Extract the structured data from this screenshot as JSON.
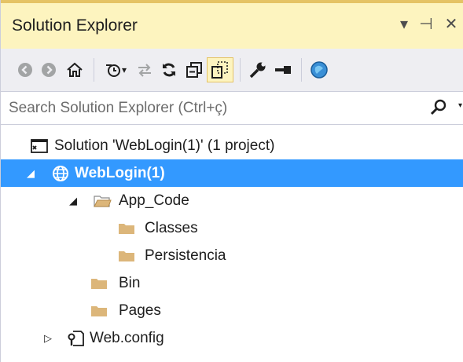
{
  "window": {
    "title": "Solution Explorer",
    "buttons": {
      "dropdown": "▾",
      "pin": "⊣",
      "close": "✕"
    }
  },
  "toolbar": {
    "icons": [
      "back-icon",
      "forward-icon",
      "home-icon",
      "pending-changes-icon",
      "sync-icon",
      "refresh-icon",
      "collapse-all-icon",
      "show-all-files-icon",
      "properties-icon",
      "preview-icon",
      "browser-icon"
    ]
  },
  "search": {
    "placeholder": "Search Solution Explorer (Ctrl+ç)"
  },
  "tree": {
    "solution": {
      "label": "Solution 'WebLogin(1)' (1 project)"
    },
    "project": {
      "label": "WebLogin(1)",
      "expanded": true,
      "selected": true
    },
    "app_code": {
      "label": "App_Code",
      "expanded": true
    },
    "classes": {
      "label": "Classes"
    },
    "persistencia": {
      "label": "Persistencia"
    },
    "bin": {
      "label": "Bin"
    },
    "pages": {
      "label": "Pages"
    },
    "webconfig": {
      "label": "Web.config",
      "expanded": false
    }
  },
  "colors": {
    "selection": "#3399ff",
    "titlebar": "#fdf4bf",
    "folder": "#dcb67a"
  }
}
